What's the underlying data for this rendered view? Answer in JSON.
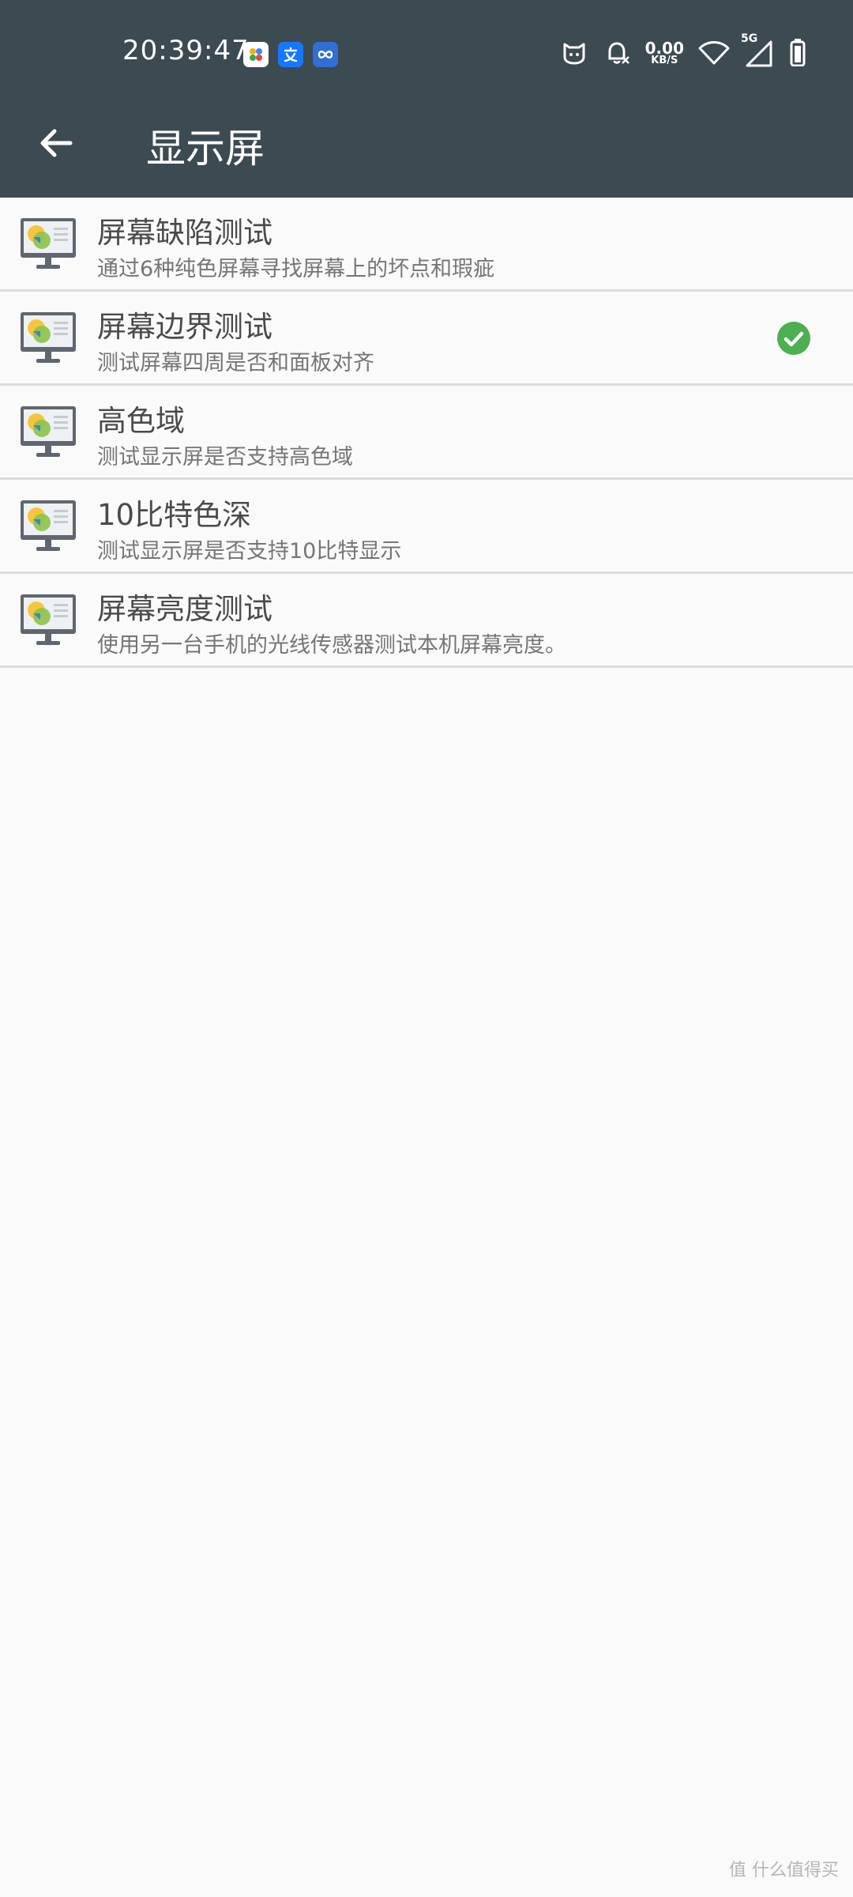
{
  "status_bar": {
    "time": "20:39:47",
    "net_speed_value": "0.00",
    "net_speed_unit": "KB/S",
    "network_type": "5G",
    "app_icons": [
      "flower-app-icon",
      "alipay-icon",
      "infinity-app-icon"
    ]
  },
  "toolbar": {
    "title": "显示屏"
  },
  "items": [
    {
      "title": "屏幕缺陷测试",
      "desc": "通过6种纯色屏幕寻找屏幕上的坏点和瑕疵",
      "checked": false
    },
    {
      "title": "屏幕边界测试",
      "desc": "测试屏幕四周是否和面板对齐",
      "checked": true
    },
    {
      "title": "高色域",
      "desc": "测试显示屏是否支持高色域",
      "checked": false
    },
    {
      "title": "10比特色深",
      "desc": "测试显示屏是否支持10比特显示",
      "checked": false
    },
    {
      "title": "屏幕亮度测试",
      "desc": "使用另一台手机的光线传感器测试本机屏幕亮度。",
      "checked": false
    }
  ],
  "watermark": "值 什么值得买",
  "colors": {
    "header_bg": "#3c4a51",
    "check_green": "#4caf50",
    "background": "#fafafa"
  }
}
